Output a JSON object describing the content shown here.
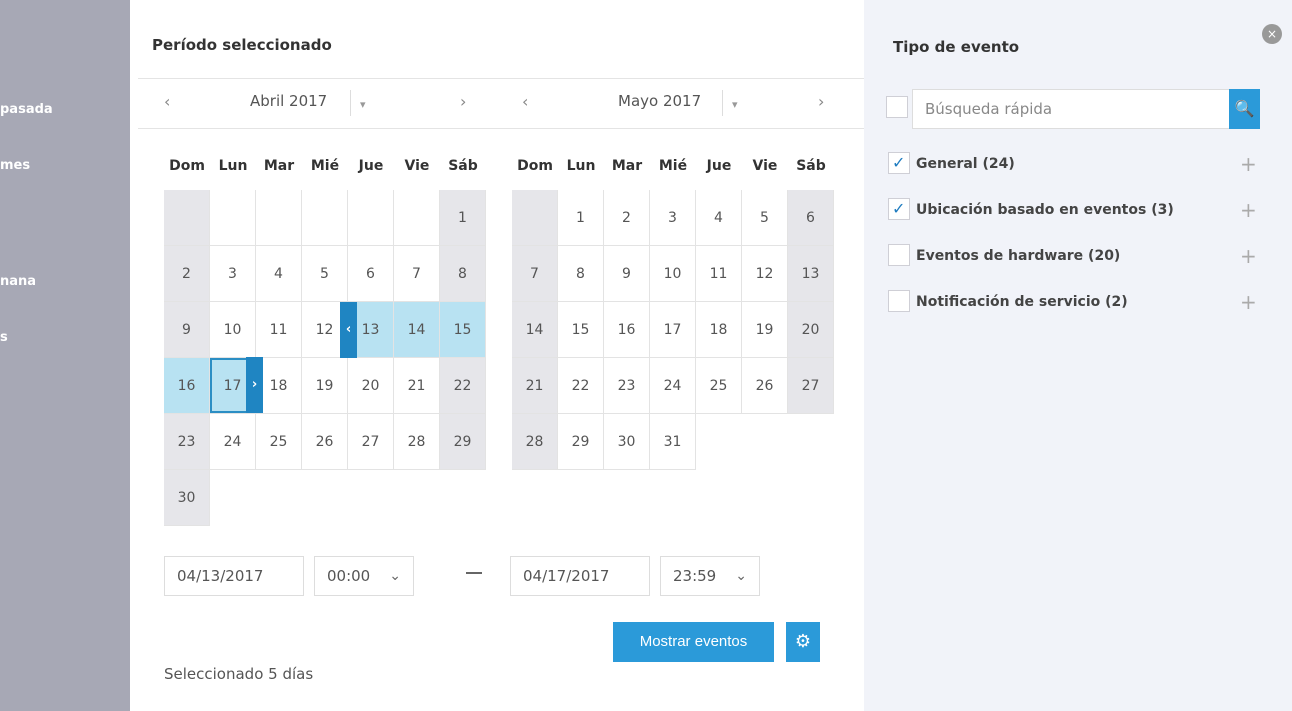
{
  "sidebar": {
    "items": [
      {
        "label": "pasada"
      },
      {
        "label": "mes"
      },
      {
        "label": "nana"
      },
      {
        "label": "s"
      }
    ]
  },
  "period": {
    "title": "Período seleccionado",
    "left_month": "Abril 2017",
    "right_month": "Mayo 2017",
    "nav_prev": "‹",
    "nav_next": "›",
    "dropdown_caret": "▾",
    "weekdays": [
      "Dom",
      "Lun",
      "Mar",
      "Mié",
      "Jue",
      "Vie",
      "Sáb"
    ],
    "april_days": [
      [
        "",
        "",
        "",
        "",
        "",
        "",
        "1"
      ],
      [
        "2",
        "3",
        "4",
        "5",
        "6",
        "7",
        "8"
      ],
      [
        "9",
        "10",
        "11",
        "12",
        "13",
        "14",
        "15"
      ],
      [
        "16",
        "17",
        "18",
        "19",
        "20",
        "21",
        "22"
      ],
      [
        "23",
        "24",
        "25",
        "26",
        "27",
        "28",
        "29"
      ],
      [
        "30",
        "",
        "",
        "",
        "",
        "",
        ""
      ]
    ],
    "may_days": [
      [
        "",
        "1",
        "2",
        "3",
        "4",
        "5",
        "6"
      ],
      [
        "7",
        "8",
        "9",
        "10",
        "11",
        "12",
        "13"
      ],
      [
        "14",
        "15",
        "16",
        "17",
        "18",
        "19",
        "20"
      ],
      [
        "21",
        "22",
        "23",
        "24",
        "25",
        "26",
        "27"
      ],
      [
        "28",
        "29",
        "30",
        "31",
        "",
        "",
        ""
      ]
    ],
    "handle_start": "‹",
    "handle_end": "›",
    "start_date": "04/13/2017",
    "start_time": "00:00",
    "end_date": "04/17/2017",
    "end_time": "23:59",
    "chevron": "⌄",
    "show_button": "Mostrar eventos",
    "gear": "⚙",
    "selected_text": "Seleccionado 5 días"
  },
  "events": {
    "title": "Tipo de evento",
    "close": "×",
    "search_placeholder": "Búsqueda rápida",
    "search_icon": "🔍",
    "items": [
      {
        "label": "General (24)",
        "checked": true
      },
      {
        "label": "Ubicación basado en eventos (3)",
        "checked": true
      },
      {
        "label": "Eventos de hardware (20)",
        "checked": false
      },
      {
        "label": "Notificación de servicio (2)",
        "checked": false
      }
    ],
    "plus": "+"
  },
  "colors": {
    "accent": "#2b9ad9",
    "range": "#b8e2f2",
    "weekend": "#e6e6ea",
    "sidebar": "#a7a8b5",
    "panel": "#f1f3f9"
  }
}
